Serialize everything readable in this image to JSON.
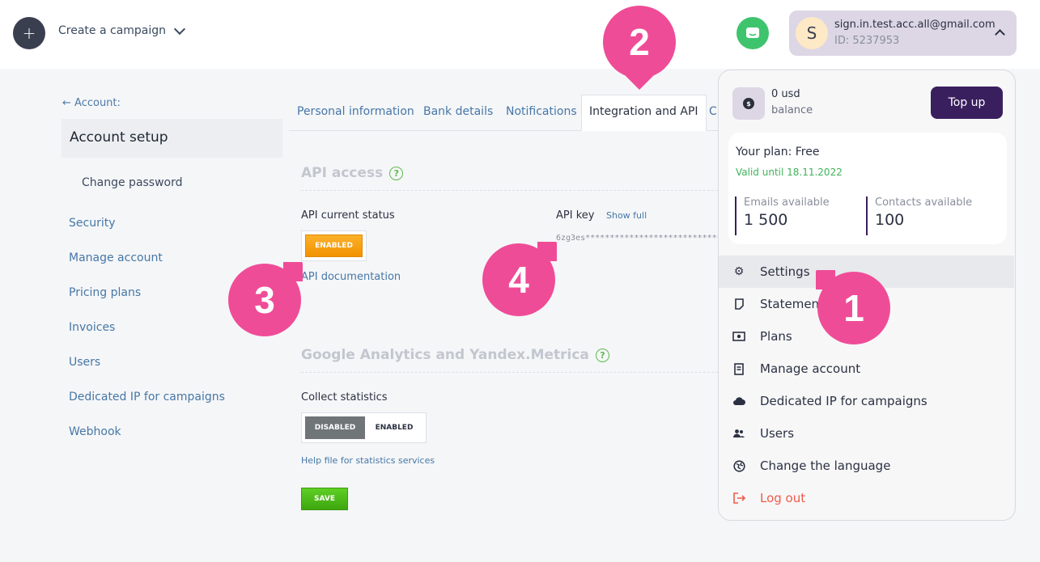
{
  "topbar": {
    "plus": "+",
    "create_campaign": "Create a campaign",
    "user_initial": "S",
    "user_email": "sign.in.test.acc.all@gmail.com",
    "user_id": "ID: 5237953"
  },
  "sidebar": {
    "back": "← Account:",
    "section_title": "Account setup",
    "change_password": "Change password",
    "items": [
      "Security",
      "Manage account",
      "Pricing plans",
      "Invoices",
      "Users",
      "Dedicated IP for campaigns",
      "Webhook"
    ]
  },
  "tabs": [
    "Personal information",
    "Bank details",
    "Notifications",
    "Integration and API",
    "C"
  ],
  "api": {
    "title": "API access",
    "status_label": "API current status",
    "status_value": "ENABLED",
    "doc_link": "API documentation",
    "key_label": "API key",
    "show_full": "Show full",
    "key_value": "6zg3es*******************************"
  },
  "analytics": {
    "title": "Google Analytics and Yandex.Metrica",
    "collect_label": "Collect statistics",
    "disabled": "DISABLED",
    "enabled": "ENABLED",
    "help_link": "Help file for statistics services",
    "save": "SAVE"
  },
  "dropdown": {
    "balance_amount": "0 usd",
    "balance_label": "balance",
    "topup": "Top up",
    "plan": "Your plan: Free",
    "valid": "Valid until 18.11.2022",
    "emails_label": "Emails available",
    "emails_value": "1 500",
    "contacts_label": "Contacts available",
    "contacts_value": "100",
    "menu": [
      "Settings",
      "Statements",
      "Plans",
      "Manage account",
      "Dedicated IP for campaigns",
      "Users",
      "Change the language",
      "Log out"
    ]
  },
  "markers": [
    "1",
    "2",
    "3",
    "4"
  ],
  "colors": {
    "accent": "#3a1f5e",
    "marker": "#ef4c97",
    "link": "#4677a6",
    "enabled": "#f29200",
    "save": "#4fbd1a"
  }
}
